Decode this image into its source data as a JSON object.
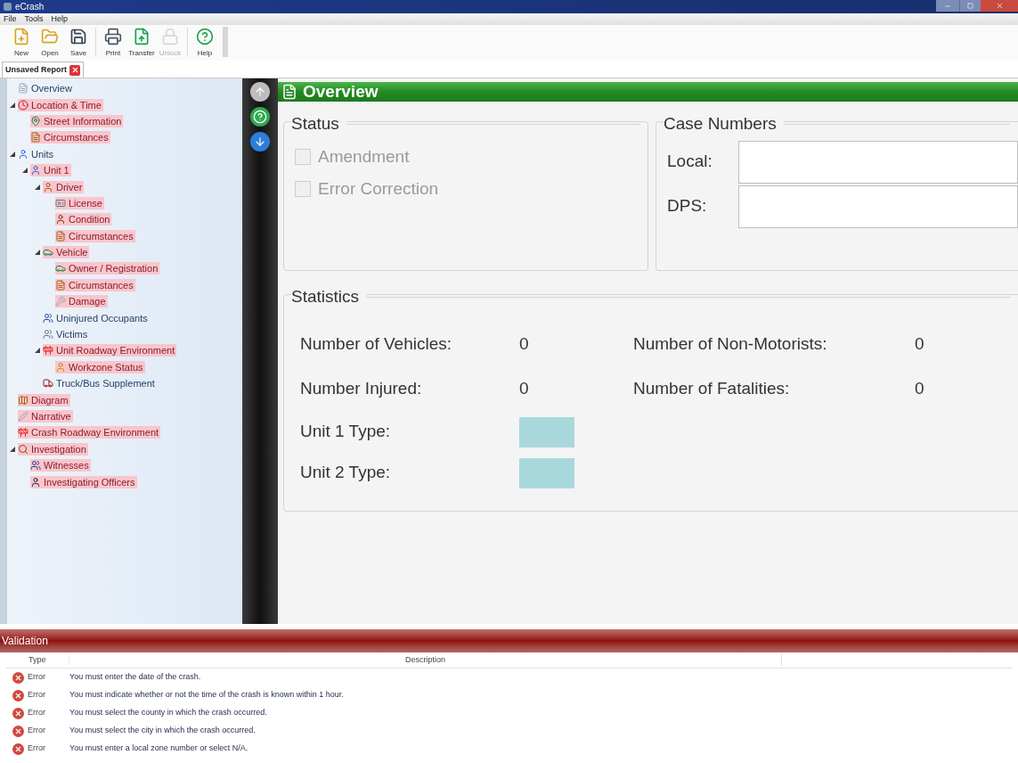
{
  "window": {
    "title": "eCrash"
  },
  "menu": [
    "File",
    "Tools",
    "Help"
  ],
  "toolbar": [
    {
      "label": "New",
      "disabled": false,
      "separated": false
    },
    {
      "label": "Open",
      "disabled": false,
      "separated": false
    },
    {
      "label": "Save",
      "disabled": false,
      "separated": false
    },
    {
      "label": "Print",
      "disabled": false,
      "separated": true
    },
    {
      "label": "Transfer",
      "disabled": false,
      "separated": false
    },
    {
      "label": "Unlock",
      "disabled": true,
      "separated": false
    },
    {
      "label": "Help",
      "disabled": false,
      "separated": true
    }
  ],
  "tabs": [
    {
      "label": "Unsaved Report",
      "selected": true
    }
  ],
  "tree": [
    {
      "label": "Overview",
      "flagged": false
    },
    {
      "label": "Location & Time",
      "flagged": true,
      "expanded": true,
      "children": [
        {
          "label": "Street Information",
          "flagged": true
        },
        {
          "label": "Circumstances",
          "flagged": true
        }
      ]
    },
    {
      "label": "Units",
      "flagged": false,
      "expanded": true,
      "children": [
        {
          "label": "Unit 1",
          "flagged": true,
          "expanded": true,
          "children": [
            {
              "label": "Driver",
              "flagged": true,
              "expanded": true,
              "children": [
                {
                  "label": "License",
                  "flagged": true
                },
                {
                  "label": "Condition",
                  "flagged": true
                },
                {
                  "label": "Circumstances",
                  "flagged": true
                }
              ]
            },
            {
              "label": "Vehicle",
              "flagged": true,
              "expanded": true,
              "children": [
                {
                  "label": "Owner / Registration",
                  "flagged": true
                },
                {
                  "label": "Circumstances",
                  "flagged": true
                },
                {
                  "label": "Damage",
                  "flagged": true
                }
              ]
            },
            {
              "label": "Uninjured Occupants",
              "flagged": false
            },
            {
              "label": "Victims",
              "flagged": false
            },
            {
              "label": "Unit Roadway Environment",
              "flagged": true,
              "expanded": true,
              "children": [
                {
                  "label": "Workzone Status",
                  "flagged": true
                }
              ]
            },
            {
              "label": "Truck/Bus Supplement",
              "flagged": false
            }
          ]
        }
      ]
    },
    {
      "label": "Diagram",
      "flagged": true
    },
    {
      "label": "Narrative",
      "flagged": true
    },
    {
      "label": "Crash Roadway Environment",
      "flagged": true
    },
    {
      "label": "Investigation",
      "flagged": true,
      "expanded": true,
      "children": [
        {
          "label": "Witnesses",
          "flagged": true
        },
        {
          "label": "Investigating Officers",
          "flagged": true
        }
      ]
    }
  ],
  "section": {
    "title": "Overview"
  },
  "status": {
    "title": "Status",
    "options": [
      {
        "label": "Amendment",
        "checked": false,
        "disabled": true
      },
      {
        "label": "Error Correction",
        "checked": false,
        "disabled": true
      }
    ]
  },
  "case_numbers": {
    "title": "Case Numbers",
    "fields": [
      {
        "label": "Local:"
      },
      {
        "label": "DPS:"
      }
    ]
  },
  "statistics": {
    "title": "Statistics",
    "rows": [
      [
        {
          "label": "Number of Vehicles:",
          "value": "0"
        },
        {
          "label": "Number of Non-Motorists:",
          "value": "0"
        }
      ],
      [
        {
          "label": "Number Injured:",
          "value": "0"
        },
        {
          "label": "Number of Fatalities:",
          "value": "0"
        }
      ]
    ],
    "types": [
      {
        "label": "Unit 1 Type:"
      },
      {
        "label": "Unit 2 Type:"
      }
    ]
  },
  "validation": {
    "title": "Validation",
    "columns": [
      "Type",
      "Description"
    ],
    "rows": [
      {
        "type": "Error",
        "description": "You must enter the date of the crash."
      },
      {
        "type": "Error",
        "description": "You must indicate whether or not the time of the crash is known within 1 hour."
      },
      {
        "type": "Error",
        "description": "You must select the county in which the crash occurred."
      },
      {
        "type": "Error",
        "description": "You must select the city in which the crash occurred."
      },
      {
        "type": "Error",
        "description": "You must enter a local zone number or select N/A."
      }
    ]
  }
}
